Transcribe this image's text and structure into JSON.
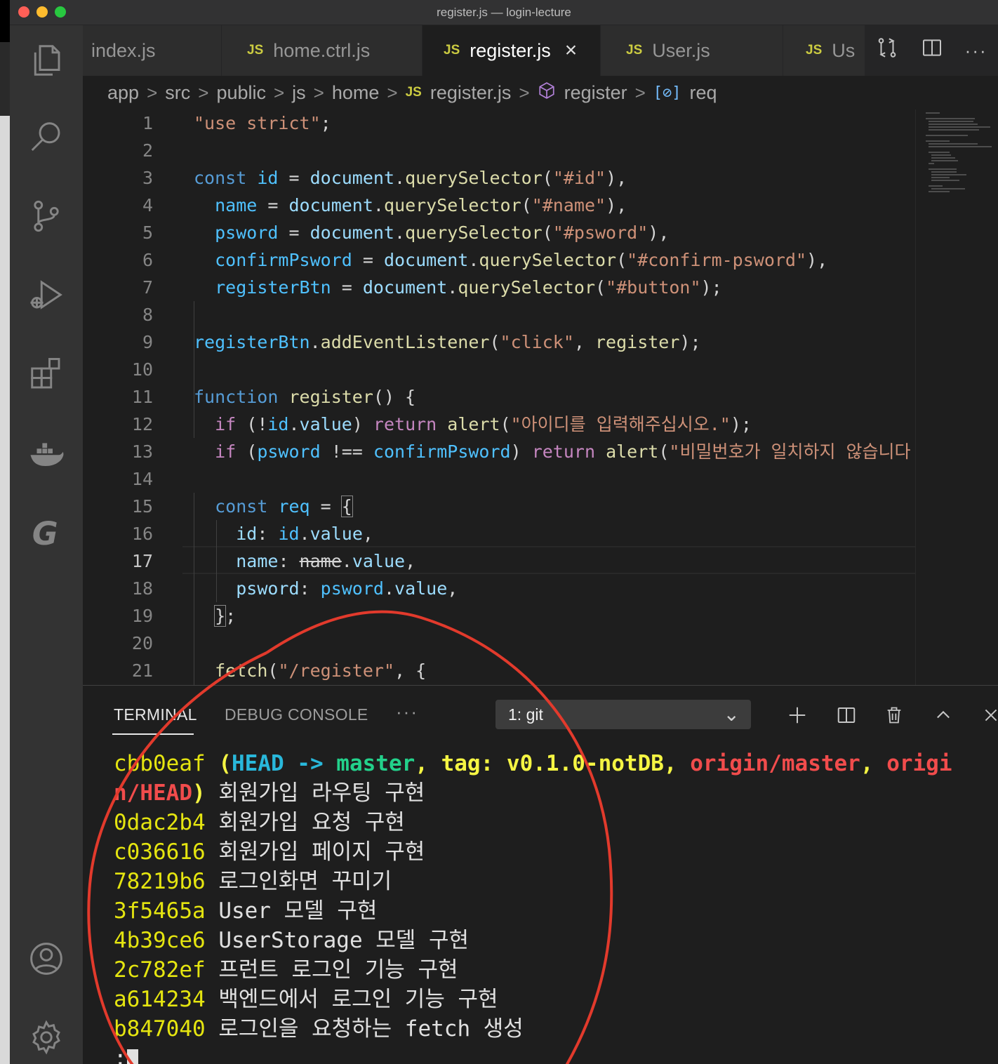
{
  "window": {
    "title": "register.js — login-lecture"
  },
  "activity_bar": {
    "top": [
      "files-icon",
      "search-icon",
      "source-control-icon",
      "run-debug-icon",
      "extensions-icon",
      "docker-icon",
      "gitlens-icon"
    ],
    "bottom": [
      "account-icon",
      "settings-gear-icon"
    ]
  },
  "tabs": [
    {
      "label": "index.js",
      "js": false
    },
    {
      "label": "home.ctrl.js",
      "js": true
    },
    {
      "label": "register.js",
      "js": true,
      "active": true
    },
    {
      "label": "User.js",
      "js": true
    },
    {
      "label": "Us",
      "js": true
    }
  ],
  "tab_badge": "JS",
  "tab_close": "×",
  "breadcrumb": [
    "app",
    "src",
    "public",
    "js",
    "home",
    "register.js",
    "register",
    "req"
  ],
  "editor": {
    "current_line": 17,
    "line_numbers": [
      "1",
      "2",
      "3",
      "4",
      "5",
      "6",
      "7",
      "8",
      "9",
      "10",
      "11",
      "12",
      "13",
      "14",
      "15",
      "16",
      "17",
      "18",
      "19",
      "20",
      "21"
    ]
  },
  "panel": {
    "tabs": [
      "TERMINAL",
      "DEBUG CONSOLE",
      "···"
    ],
    "terminal_select": "1: git",
    "actions": [
      "new-terminal",
      "split-terminal",
      "kill-terminal",
      "maximize-panel",
      "close-panel"
    ]
  },
  "terminal": {
    "first": {
      "hash": "cbb0eaf",
      "open": " (",
      "head": "HEAD -> ",
      "master": "master",
      "comma1": ", ",
      "tag": "tag: v0.1.0-notDB",
      "comma2": ", ",
      "origin_master": "origin/master",
      "comma3": ", ",
      "origin_head_a": "origi",
      "origin_head_b": "n/HEAD",
      "close": ")",
      "message": " 회원가입 라우팅 구현"
    },
    "commits": [
      {
        "hash": "0dac2b4",
        "message": " 회원가입 요청 구현"
      },
      {
        "hash": "c036616",
        "message": " 회원가입 페이지 구현"
      },
      {
        "hash": "78219b6",
        "message": " 로그인화면 꾸미기"
      },
      {
        "hash": "3f5465a",
        "message": " User 모델 구현"
      },
      {
        "hash": "4b39ce6",
        "message": " UserStorage 모델 구현"
      },
      {
        "hash": "2c782ef",
        "message": " 프런트 로그인 기능 구현"
      },
      {
        "hash": "a614234",
        "message": " 백엔드에서 로그인 기능 구현"
      },
      {
        "hash": "b847040",
        "message": " 로그인을 요청하는 fetch 생성"
      }
    ],
    "prompt": ":"
  },
  "colors": {
    "editor_bg": "#1e1e1e",
    "annotation_circle": "#e23a2c",
    "keyword": "#569cd6",
    "string": "#ce9178",
    "hash": "#e5e510"
  }
}
